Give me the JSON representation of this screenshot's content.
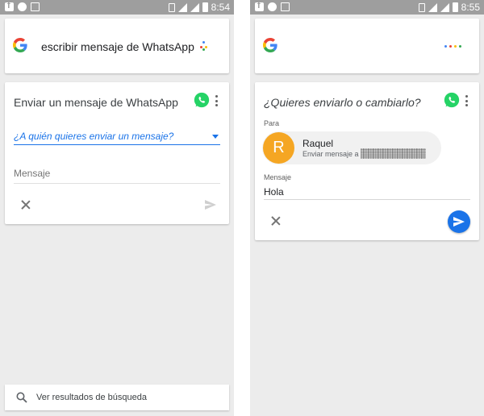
{
  "left_screen": {
    "status_bar": {
      "time": "8:54"
    },
    "search": {
      "query": "escribir mensaje de WhatsApp"
    },
    "card": {
      "title": "Enviar un mensaje de WhatsApp",
      "recipient_prompt": "¿A quién quieres enviar un mensaje?",
      "message_placeholder": "Mensaje"
    },
    "bottom_bar": {
      "label": "Ver resultados de búsqueda"
    }
  },
  "right_screen": {
    "status_bar": {
      "time": "8:55"
    },
    "card": {
      "title": "¿Quieres enviarlo o cambiarlo?",
      "to_label": "Para",
      "contact": {
        "initial": "R",
        "name": "Raquel",
        "subtitle": "Enviar mensaje a"
      },
      "message_label": "Mensaje",
      "message_value": "Hola"
    }
  },
  "colors": {
    "accent_blue": "#1a73e8",
    "whatsapp_green": "#25d366",
    "avatar_orange": "#f5a623",
    "status_bar": "#9e9e9e",
    "background": "#ececec"
  },
  "icons": [
    "google-logo",
    "whatsapp-icon",
    "more-vert-icon",
    "close-icon",
    "send-icon",
    "search-icon",
    "assistant-dots-icon"
  ]
}
